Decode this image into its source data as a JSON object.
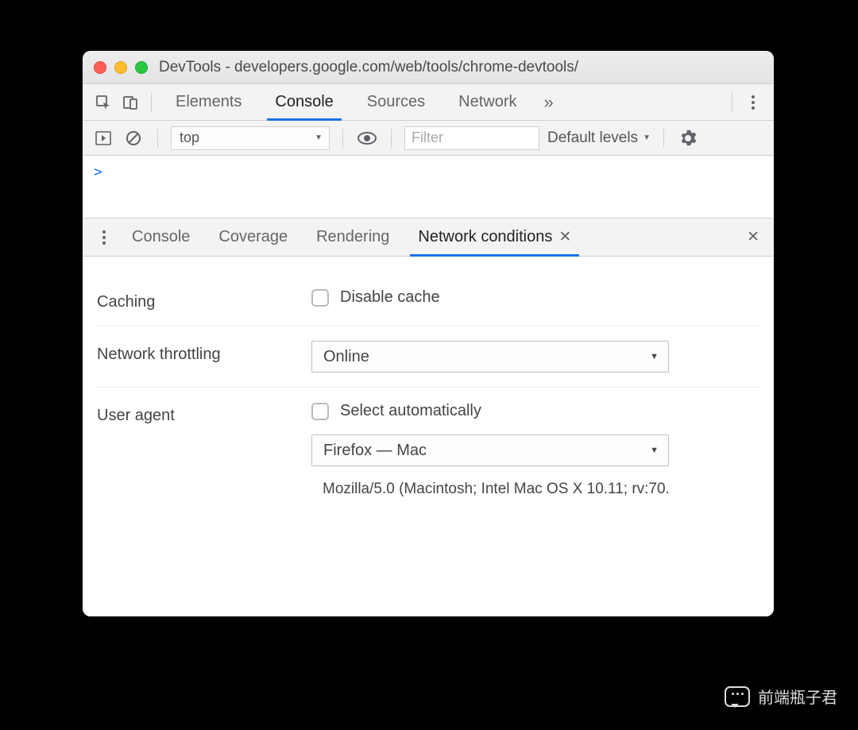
{
  "window": {
    "title": "DevTools - developers.google.com/web/tools/chrome-devtools/"
  },
  "tabs": {
    "items": [
      "Elements",
      "Console",
      "Sources",
      "Network"
    ],
    "active": 1
  },
  "console_toolbar": {
    "context": "top",
    "filter_placeholder": "Filter",
    "levels": "Default levels"
  },
  "console_body": {
    "prompt": ">"
  },
  "drawer": {
    "tabs": [
      "Console",
      "Coverage",
      "Rendering",
      "Network conditions"
    ],
    "active": 3
  },
  "network_conditions": {
    "caching": {
      "label": "Caching",
      "checkbox_label": "Disable cache",
      "checked": false
    },
    "throttling": {
      "label": "Network throttling",
      "value": "Online"
    },
    "user_agent": {
      "label": "User agent",
      "auto_label": "Select automatically",
      "auto_checked": false,
      "value": "Firefox — Mac",
      "ua_string": "Mozilla/5.0 (Macintosh; Intel Mac OS X 10.11; rv:70."
    }
  },
  "watermark": "前端瓶子君"
}
